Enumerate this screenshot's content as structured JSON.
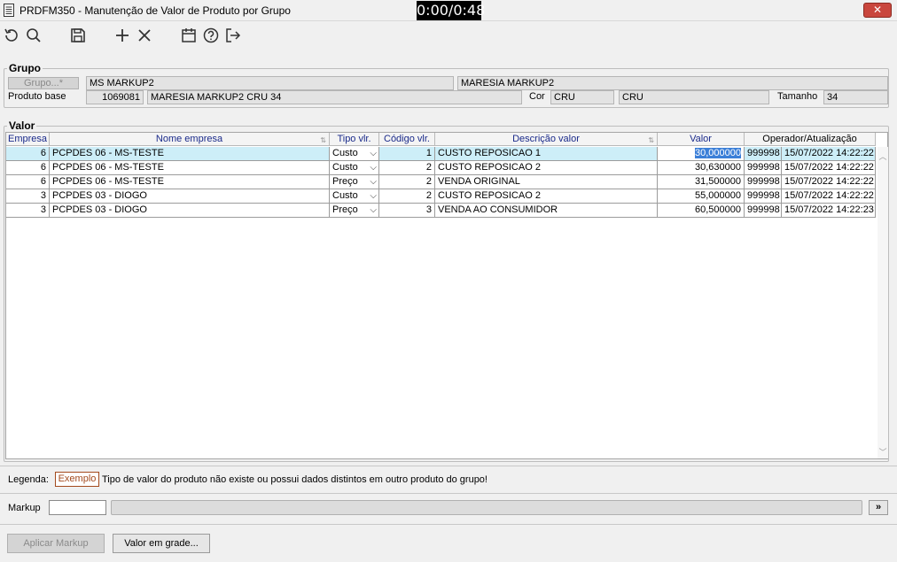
{
  "window": {
    "title": "PRDFM350 - Manutenção de Valor de Produto por Grupo",
    "timer": "0:00/0:48",
    "close_label": "✕"
  },
  "toolbar": {
    "icons": [
      "refresh-icon",
      "search-icon",
      "save-icon",
      "add-icon",
      "delete-icon",
      "calendar-icon",
      "help-icon",
      "exit-icon"
    ]
  },
  "grupo": {
    "legend": "Grupo",
    "grupo_button": "Grupo...*",
    "grupo_code": "MS MARKUP2",
    "grupo_desc": "MARESIA MARKUP2",
    "produto_base_label": "Produto base",
    "produto_code": "1069081",
    "produto_desc": "MARESIA MARKUP2 CRU 34",
    "cor_label": "Cor",
    "cor_code": "CRU",
    "cor_desc": "CRU",
    "tamanho_label": "Tamanho",
    "tamanho_value": "34"
  },
  "valor": {
    "legend": "Valor",
    "columns": [
      "Empresa",
      "Nome empresa",
      "Tipo vlr.",
      "Código vlr.",
      "Descrição valor",
      "Valor",
      "Operador/Atualização"
    ],
    "rows": [
      {
        "empresa": "6",
        "nome": "PCPDES 06 - MS-TESTE",
        "tipo": "Custo",
        "codigo": "1",
        "descricao": "CUSTO REPOSICAO 1",
        "valor": "30,000000",
        "operador": "999998",
        "atualizacao": "15/07/2022 14:22:22"
      },
      {
        "empresa": "6",
        "nome": "PCPDES 06 - MS-TESTE",
        "tipo": "Custo",
        "codigo": "2",
        "descricao": "CUSTO REPOSICAO 2",
        "valor": "30,630000",
        "operador": "999998",
        "atualizacao": "15/07/2022 14:22:22"
      },
      {
        "empresa": "6",
        "nome": "PCPDES 06 - MS-TESTE",
        "tipo": "Preço",
        "codigo": "2",
        "descricao": "VENDA ORIGINAL",
        "valor": "31,500000",
        "operador": "999998",
        "atualizacao": "15/07/2022 14:22:22"
      },
      {
        "empresa": "3",
        "nome": "PCPDES 03 - DIOGO",
        "tipo": "Custo",
        "codigo": "2",
        "descricao": "CUSTO REPOSICAO 2",
        "valor": "55,000000",
        "operador": "999998",
        "atualizacao": "15/07/2022 14:22:22"
      },
      {
        "empresa": "3",
        "nome": "PCPDES 03 - DIOGO",
        "tipo": "Preço",
        "codigo": "3",
        "descricao": "VENDA AO CONSUMIDOR",
        "valor": "60,500000",
        "operador": "999998",
        "atualizacao": "15/07/2022 14:22:23"
      }
    ]
  },
  "legenda": {
    "label": "Legenda:",
    "example": "Exemplo",
    "text": "Tipo de valor do produto não existe ou possui dados distintos em outro produto do grupo!"
  },
  "markup": {
    "label": "Markup",
    "value": "",
    "expand_button": "»"
  },
  "buttons": {
    "aplicar": "Aplicar Markup",
    "valor_grade": "Valor em grade..."
  }
}
